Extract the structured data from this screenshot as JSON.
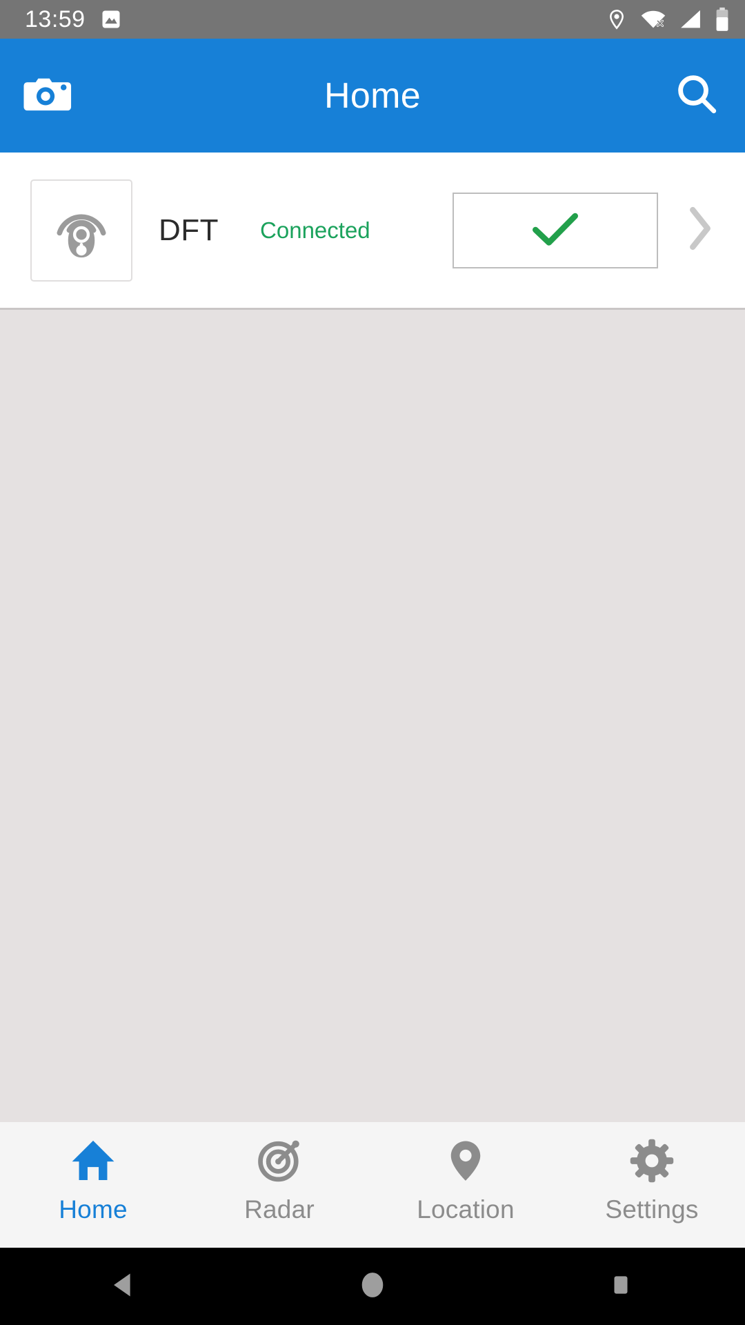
{
  "status_bar": {
    "clock": "13:59",
    "background": "#757575",
    "notification_icons": [
      "gallery-image-icon"
    ],
    "system_icons": [
      "location-pin-icon",
      "wifi-off-icon",
      "cellular-signal-icon",
      "battery-icon"
    ]
  },
  "app_bar": {
    "title": "Home",
    "background": "#1780D7",
    "left_icon": "camera-icon",
    "right_icon": "search-icon"
  },
  "device_card": {
    "thumbnail_icon": "key-fob-signal-icon",
    "name": "DFT",
    "status": "Connected",
    "status_color": "#1BA25C",
    "action_icon": "check-icon",
    "action_color": "#22A04B",
    "disclosure_icon": "chevron-right-icon"
  },
  "content": {
    "background": "#E5E1E1"
  },
  "bottom_nav": {
    "background": "#F5F5F5",
    "active_color": "#1780D7",
    "inactive_color": "#8C8C8C",
    "items": [
      {
        "label": "Home",
        "icon": "home-icon",
        "active": true
      },
      {
        "label": "Radar",
        "icon": "radar-icon",
        "active": false
      },
      {
        "label": "Location",
        "icon": "location-pin-icon",
        "active": false
      },
      {
        "label": "Settings",
        "icon": "gear-icon",
        "active": false
      }
    ]
  },
  "android_nav": {
    "background": "#000000",
    "buttons": [
      {
        "icon": "back-triangle-icon"
      },
      {
        "icon": "home-circle-icon"
      },
      {
        "icon": "recents-square-icon"
      }
    ]
  }
}
